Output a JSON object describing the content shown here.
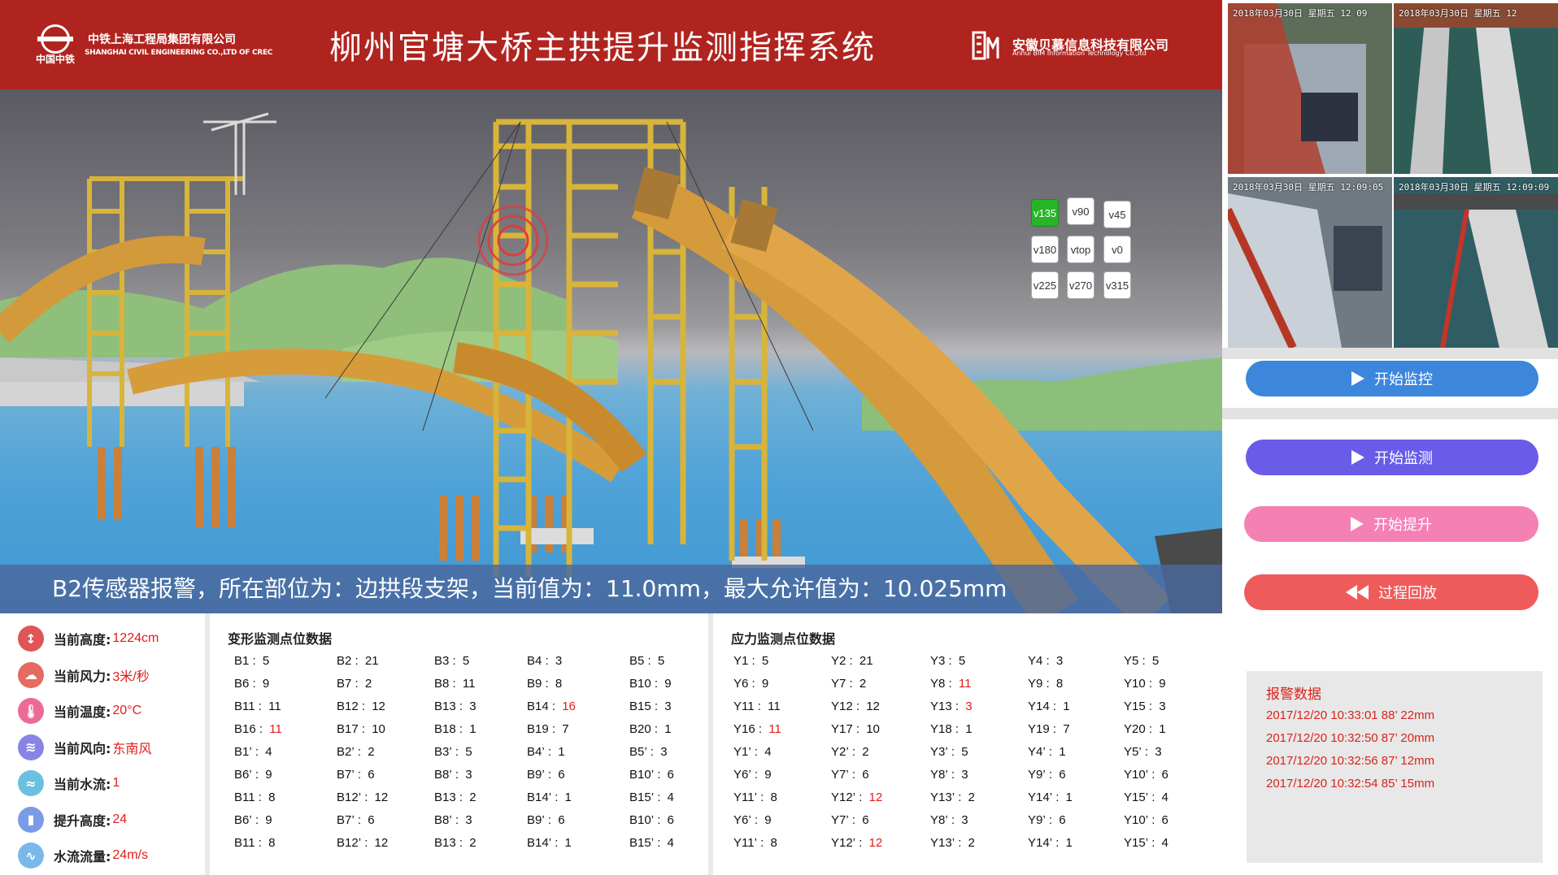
{
  "header": {
    "crec_short": "中国中铁",
    "company_cn": "中铁上海工程局集团有限公司",
    "company_en": "SHANGHAI CIVIL ENGINEERING CO.,LTD OF CREC",
    "title": "柳州官塘大桥主拱提升监测指挥系统",
    "vendor_cn": "安徽贝慕信息科技有限公司",
    "vendor_en": "Anhui BIM Information Technology Co.,ltd"
  },
  "view_buttons": [
    "v135",
    "v90",
    "v45",
    "v180",
    "vtop",
    "v0",
    "v225",
    "v270",
    "v315"
  ],
  "active_view": "v135",
  "alarm_banner": "B2传感器报警，所在部位为：边拱段支架，当前值为：11.0mm，最大允许值为：10.025mm",
  "cameras": [
    {
      "stamp": "2018年03月30日  星期五 12 09"
    },
    {
      "stamp": "2018年03月30日 星期五 12"
    },
    {
      "stamp": "2018年03月30日 星期五 12:09:05"
    },
    {
      "stamp": "2018年03月30日 星期五 12:09:09"
    }
  ],
  "actions": {
    "start_monitor_ctrl": "开始监控",
    "start_monitor": "开始监测",
    "start_lift": "开始提升",
    "replay": "过程回放"
  },
  "alarm_data": {
    "title": "报警数据",
    "rows": [
      "2017/12/20  10:33:01 88’   22mm",
      "2017/12/20  10:32:50 87’   20mm",
      "2017/12/20  10:32:56 87’   12mm",
      "2017/12/20  10:32:54 85’   15mm"
    ]
  },
  "stats": [
    {
      "label": "当前高度:",
      "value": "1224cm",
      "icon": "height-icon",
      "color": "#e05555",
      "glyph": "↕"
    },
    {
      "label": "当前风力:",
      "value": "3米/秒",
      "icon": "wind-icon",
      "color": "#e46a62",
      "glyph": "☁"
    },
    {
      "label": "当前温度:",
      "value": "20°C",
      "icon": "temperature-icon",
      "color": "#ec6a98",
      "glyph": "🌡"
    },
    {
      "label": "当前风向:",
      "value": "东南风",
      "icon": "wind-direction-icon",
      "color": "#8a83e6",
      "glyph": "≋"
    },
    {
      "label": "当前水流:",
      "value": "1",
      "icon": "water-flow-icon",
      "color": "#6ac0e0",
      "glyph": "≈"
    },
    {
      "label": "提升高度:",
      "value": "24",
      "icon": "lift-height-icon",
      "color": "#7a9be6",
      "glyph": "▮"
    },
    {
      "label": "水流流量:",
      "value": "24m/s",
      "icon": "flow-rate-icon",
      "color": "#79b9ea",
      "glyph": "∿"
    }
  ],
  "deformation": {
    "title": "变形监测点位数据",
    "rows": [
      [
        [
          "B1",
          "5"
        ],
        [
          "B2",
          "21"
        ],
        [
          "B3",
          "5"
        ],
        [
          "B4",
          "3"
        ],
        [
          "B5",
          "5"
        ]
      ],
      [
        [
          "B6",
          "9"
        ],
        [
          "B7",
          "2"
        ],
        [
          "B8",
          "11"
        ],
        [
          "B9",
          "8"
        ],
        [
          "B10",
          "9"
        ]
      ],
      [
        [
          "B11",
          "11"
        ],
        [
          "B12",
          "12"
        ],
        [
          "B13",
          "3"
        ],
        [
          "B14",
          "16",
          true
        ],
        [
          "B15",
          "3"
        ]
      ],
      [
        [
          "B16",
          "11",
          true
        ],
        [
          "B17",
          "10"
        ],
        [
          "B18",
          "1"
        ],
        [
          "B19",
          "7"
        ],
        [
          "B20",
          "1"
        ]
      ],
      [
        [
          "B1’",
          "4"
        ],
        [
          "B2’",
          "2"
        ],
        [
          "B3’",
          "5"
        ],
        [
          "B4’",
          "1"
        ],
        [
          "B5’",
          "3"
        ]
      ],
      [
        [
          "B6’",
          "9"
        ],
        [
          "B7’",
          "6"
        ],
        [
          "B8’",
          "3"
        ],
        [
          "B9’",
          "6"
        ],
        [
          "B10’",
          "6"
        ]
      ],
      [
        [
          "B11",
          "8"
        ],
        [
          "B12’",
          "12"
        ],
        [
          "B13",
          "2"
        ],
        [
          "B14’",
          "1"
        ],
        [
          "B15’",
          "4"
        ]
      ],
      [
        [
          "B6’",
          "9"
        ],
        [
          "B7’",
          "6"
        ],
        [
          "B8’",
          "3"
        ],
        [
          "B9’",
          "6"
        ],
        [
          "B10’",
          "6"
        ]
      ],
      [
        [
          "B11",
          "8"
        ],
        [
          "B12’",
          "12"
        ],
        [
          "B13",
          "2"
        ],
        [
          "B14’",
          "1"
        ],
        [
          "B15’",
          "4"
        ]
      ]
    ]
  },
  "stress": {
    "title": "应力监测点位数据",
    "rows": [
      [
        [
          "Y1",
          "5"
        ],
        [
          "Y2",
          "21"
        ],
        [
          "Y3",
          "5"
        ],
        [
          "Y4",
          "3"
        ],
        [
          "Y5",
          "5"
        ]
      ],
      [
        [
          "Y6",
          "9"
        ],
        [
          "Y7",
          "2"
        ],
        [
          "Y8",
          "11",
          true
        ],
        [
          "Y9",
          "8"
        ],
        [
          "Y10",
          "9"
        ]
      ],
      [
        [
          "Y11",
          "11"
        ],
        [
          "Y12",
          "12"
        ],
        [
          "Y13",
          "3",
          true
        ],
        [
          "Y14",
          "1"
        ],
        [
          "Y15",
          "3"
        ]
      ],
      [
        [
          "Y16",
          "11",
          true
        ],
        [
          "Y17",
          "10"
        ],
        [
          "Y18",
          "1"
        ],
        [
          "Y19",
          "7"
        ],
        [
          "Y20",
          "1"
        ]
      ],
      [
        [
          "Y1’",
          "4"
        ],
        [
          "Y2’",
          "2"
        ],
        [
          "Y3’",
          "5"
        ],
        [
          "Y4’",
          "1"
        ],
        [
          "Y5’",
          "3"
        ]
      ],
      [
        [
          "Y6’",
          "9"
        ],
        [
          "Y7’",
          "6"
        ],
        [
          "Y8’",
          "3"
        ],
        [
          "Y9’",
          "6"
        ],
        [
          "Y10’",
          "6"
        ]
      ],
      [
        [
          "Y11’",
          "8"
        ],
        [
          "Y12’",
          "12",
          true
        ],
        [
          "Y13’",
          "2"
        ],
        [
          "Y14’",
          "1"
        ],
        [
          "Y15’",
          "4"
        ]
      ],
      [
        [
          "Y6’",
          "9"
        ],
        [
          "Y7’",
          "6"
        ],
        [
          "Y8’",
          "3"
        ],
        [
          "Y9’",
          "6"
        ],
        [
          "Y10’",
          "6"
        ]
      ],
      [
        [
          "Y11’",
          "8"
        ],
        [
          "Y12’",
          "12",
          true
        ],
        [
          "Y13’",
          "2"
        ],
        [
          "Y14’",
          "1"
        ],
        [
          "Y15’",
          "4"
        ]
      ]
    ]
  }
}
